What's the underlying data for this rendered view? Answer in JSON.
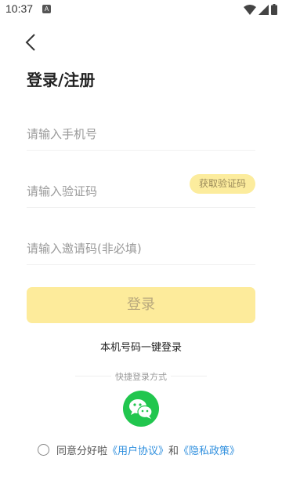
{
  "status_bar": {
    "time": "10:37",
    "notification_glyph": "A"
  },
  "page": {
    "title": "登录/注册"
  },
  "form": {
    "phone_placeholder": "请输入手机号",
    "code_placeholder": "请输入验证码",
    "get_code_label": "获取验证码",
    "invite_placeholder": "请输入邀请码(非必填)",
    "login_label": "登录"
  },
  "one_key_login": "本机号码一键登录",
  "quick_login": {
    "label": "快捷登录方式",
    "wechat_icon": "wechat-icon"
  },
  "agreement": {
    "prefix": "同意分好啦",
    "user_agreement": "《用户协议》",
    "and": "和",
    "privacy_policy": "《隐私政策》"
  },
  "colors": {
    "accent_yellow": "#fdeb9b",
    "wechat_green": "#21c64e",
    "link_blue": "#2f8fde"
  }
}
